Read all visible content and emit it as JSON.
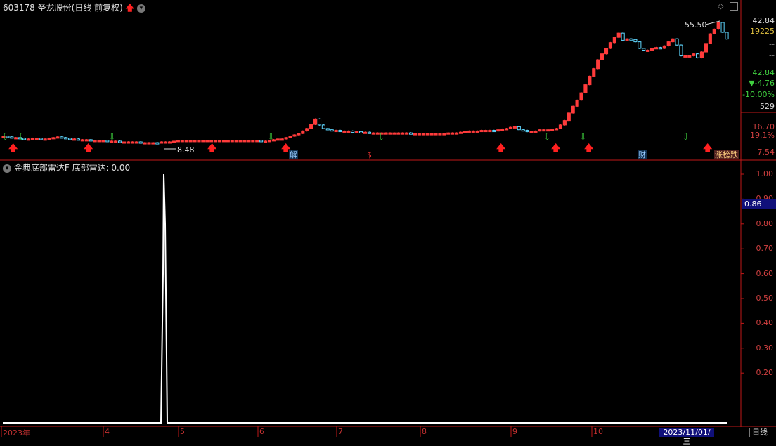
{
  "header": {
    "stock_code": "603178",
    "stock_name": "圣龙股份",
    "mode": "(日线 前复权)"
  },
  "indicator": {
    "name": "金典底部雷达F",
    "label": "底部雷达: 0.00",
    "current_box": "0.86"
  },
  "right_panel": {
    "price_top": "42.84",
    "volume": "19225",
    "dash1": "--",
    "dash2": "--",
    "price": "42.84",
    "change": "▼-4.76",
    "pct": "-10.00%",
    "val529": "529",
    "y1": "16.70",
    "y2": "19.1%",
    "y3": "7.54"
  },
  "annotations": {
    "high_label": "55.50",
    "low_label": "8.48"
  },
  "events": [
    {
      "text": "解",
      "color": "#9cf"
    },
    {
      "text": "$",
      "color": "#e03030"
    },
    {
      "text": "财",
      "color": "#9cf"
    },
    {
      "text": "涨榜跌",
      "color": "#ffd080"
    }
  ],
  "xaxis": {
    "labels": [
      "2023年",
      "4",
      "5",
      "6",
      "7",
      "8",
      "9",
      "10"
    ],
    "cursor_date": "2023/11/01/三",
    "period_tab": "日线"
  },
  "colors": {
    "up": "#ff3b3b",
    "down": "#5fd7ff",
    "signal_green": "#3ed03e",
    "signal_red": "#ff2020",
    "axis_red": "#c01818",
    "line_white": "#ffffff"
  },
  "chart_data": [
    {
      "type": "candlestick",
      "title": "603178 圣龙股份 (日线 前复权)",
      "ylabels": [
        "16.70",
        "7.54"
      ],
      "high_annotation": 55.5,
      "low_annotation": 8.48,
      "xlabels": [
        "2023年",
        "4",
        "5",
        "6",
        "7",
        "8",
        "9",
        "10"
      ],
      "close_series": [
        9.4,
        9.3,
        9.2,
        9.2,
        9.1,
        9.0,
        9.0,
        9.1,
        9.1,
        9.0,
        9.0,
        9.1,
        9.2,
        9.3,
        9.2,
        9.1,
        9.0,
        9.0,
        8.9,
        8.9,
        8.9,
        8.8,
        8.8,
        8.8,
        8.8,
        8.7,
        8.7,
        8.7,
        8.6,
        8.6,
        8.6,
        8.6,
        8.6,
        8.5,
        8.5,
        8.5,
        8.5,
        8.48,
        8.6,
        8.6,
        8.6,
        8.7,
        8.8,
        8.8,
        8.8,
        8.8,
        8.8,
        8.8,
        8.8,
        8.8,
        8.8,
        8.8,
        8.8,
        8.8,
        8.8,
        8.8,
        8.8,
        8.8,
        8.8,
        8.8,
        8.8,
        8.8,
        8.7,
        8.7,
        8.8,
        8.9,
        9.0,
        9.0,
        9.2,
        9.4,
        9.6,
        9.8,
        10.2,
        10.6,
        11.3,
        12.3,
        11.2,
        10.6,
        10.4,
        10.3,
        10.3,
        10.2,
        10.2,
        10.2,
        10.1,
        10.1,
        10.0,
        10.0,
        9.9,
        9.9,
        9.9,
        9.9,
        9.9,
        9.9,
        9.9,
        9.9,
        9.9,
        9.9,
        9.8,
        9.8,
        9.8,
        9.8,
        9.8,
        9.8,
        9.8,
        9.8,
        9.8,
        9.9,
        9.9,
        9.9,
        10.0,
        10.1,
        10.2,
        10.2,
        10.2,
        10.3,
        10.3,
        10.3,
        10.2,
        10.4,
        10.5,
        10.6,
        10.8,
        10.9,
        10.4,
        10.3,
        10.1,
        10.1,
        10.2,
        10.4,
        10.4,
        10.4,
        10.5,
        10.6,
        11.2,
        12.0,
        13.5,
        15.0,
        16.5,
        18.5,
        21.0,
        24.0,
        27.0,
        31.0,
        34.0,
        37.0,
        40.5,
        44.0,
        47.0,
        42.0,
        43.0,
        42.5,
        41.0,
        37.0,
        36.0,
        36.0,
        37.0,
        37.5,
        37.0,
        38.5,
        41.0,
        43.0,
        39.0,
        33.0,
        33.0,
        33.0,
        34.0,
        32.0,
        35.0,
        40.0,
        46.5,
        50.0,
        55.5,
        47.6,
        42.84
      ]
    },
    {
      "type": "line",
      "title": "金典底部雷达F 底部雷达: 0.00",
      "ylabels": [
        "1.00",
        "0.90",
        "0.80",
        "0.70",
        "0.60",
        "0.50",
        "0.40",
        "0.30",
        "0.20"
      ],
      "ylim": [
        0,
        1
      ],
      "series": [
        {
          "name": "底部雷达",
          "spike_at_index": 40,
          "peak": 1.0,
          "baseline": 0.0
        }
      ]
    }
  ]
}
